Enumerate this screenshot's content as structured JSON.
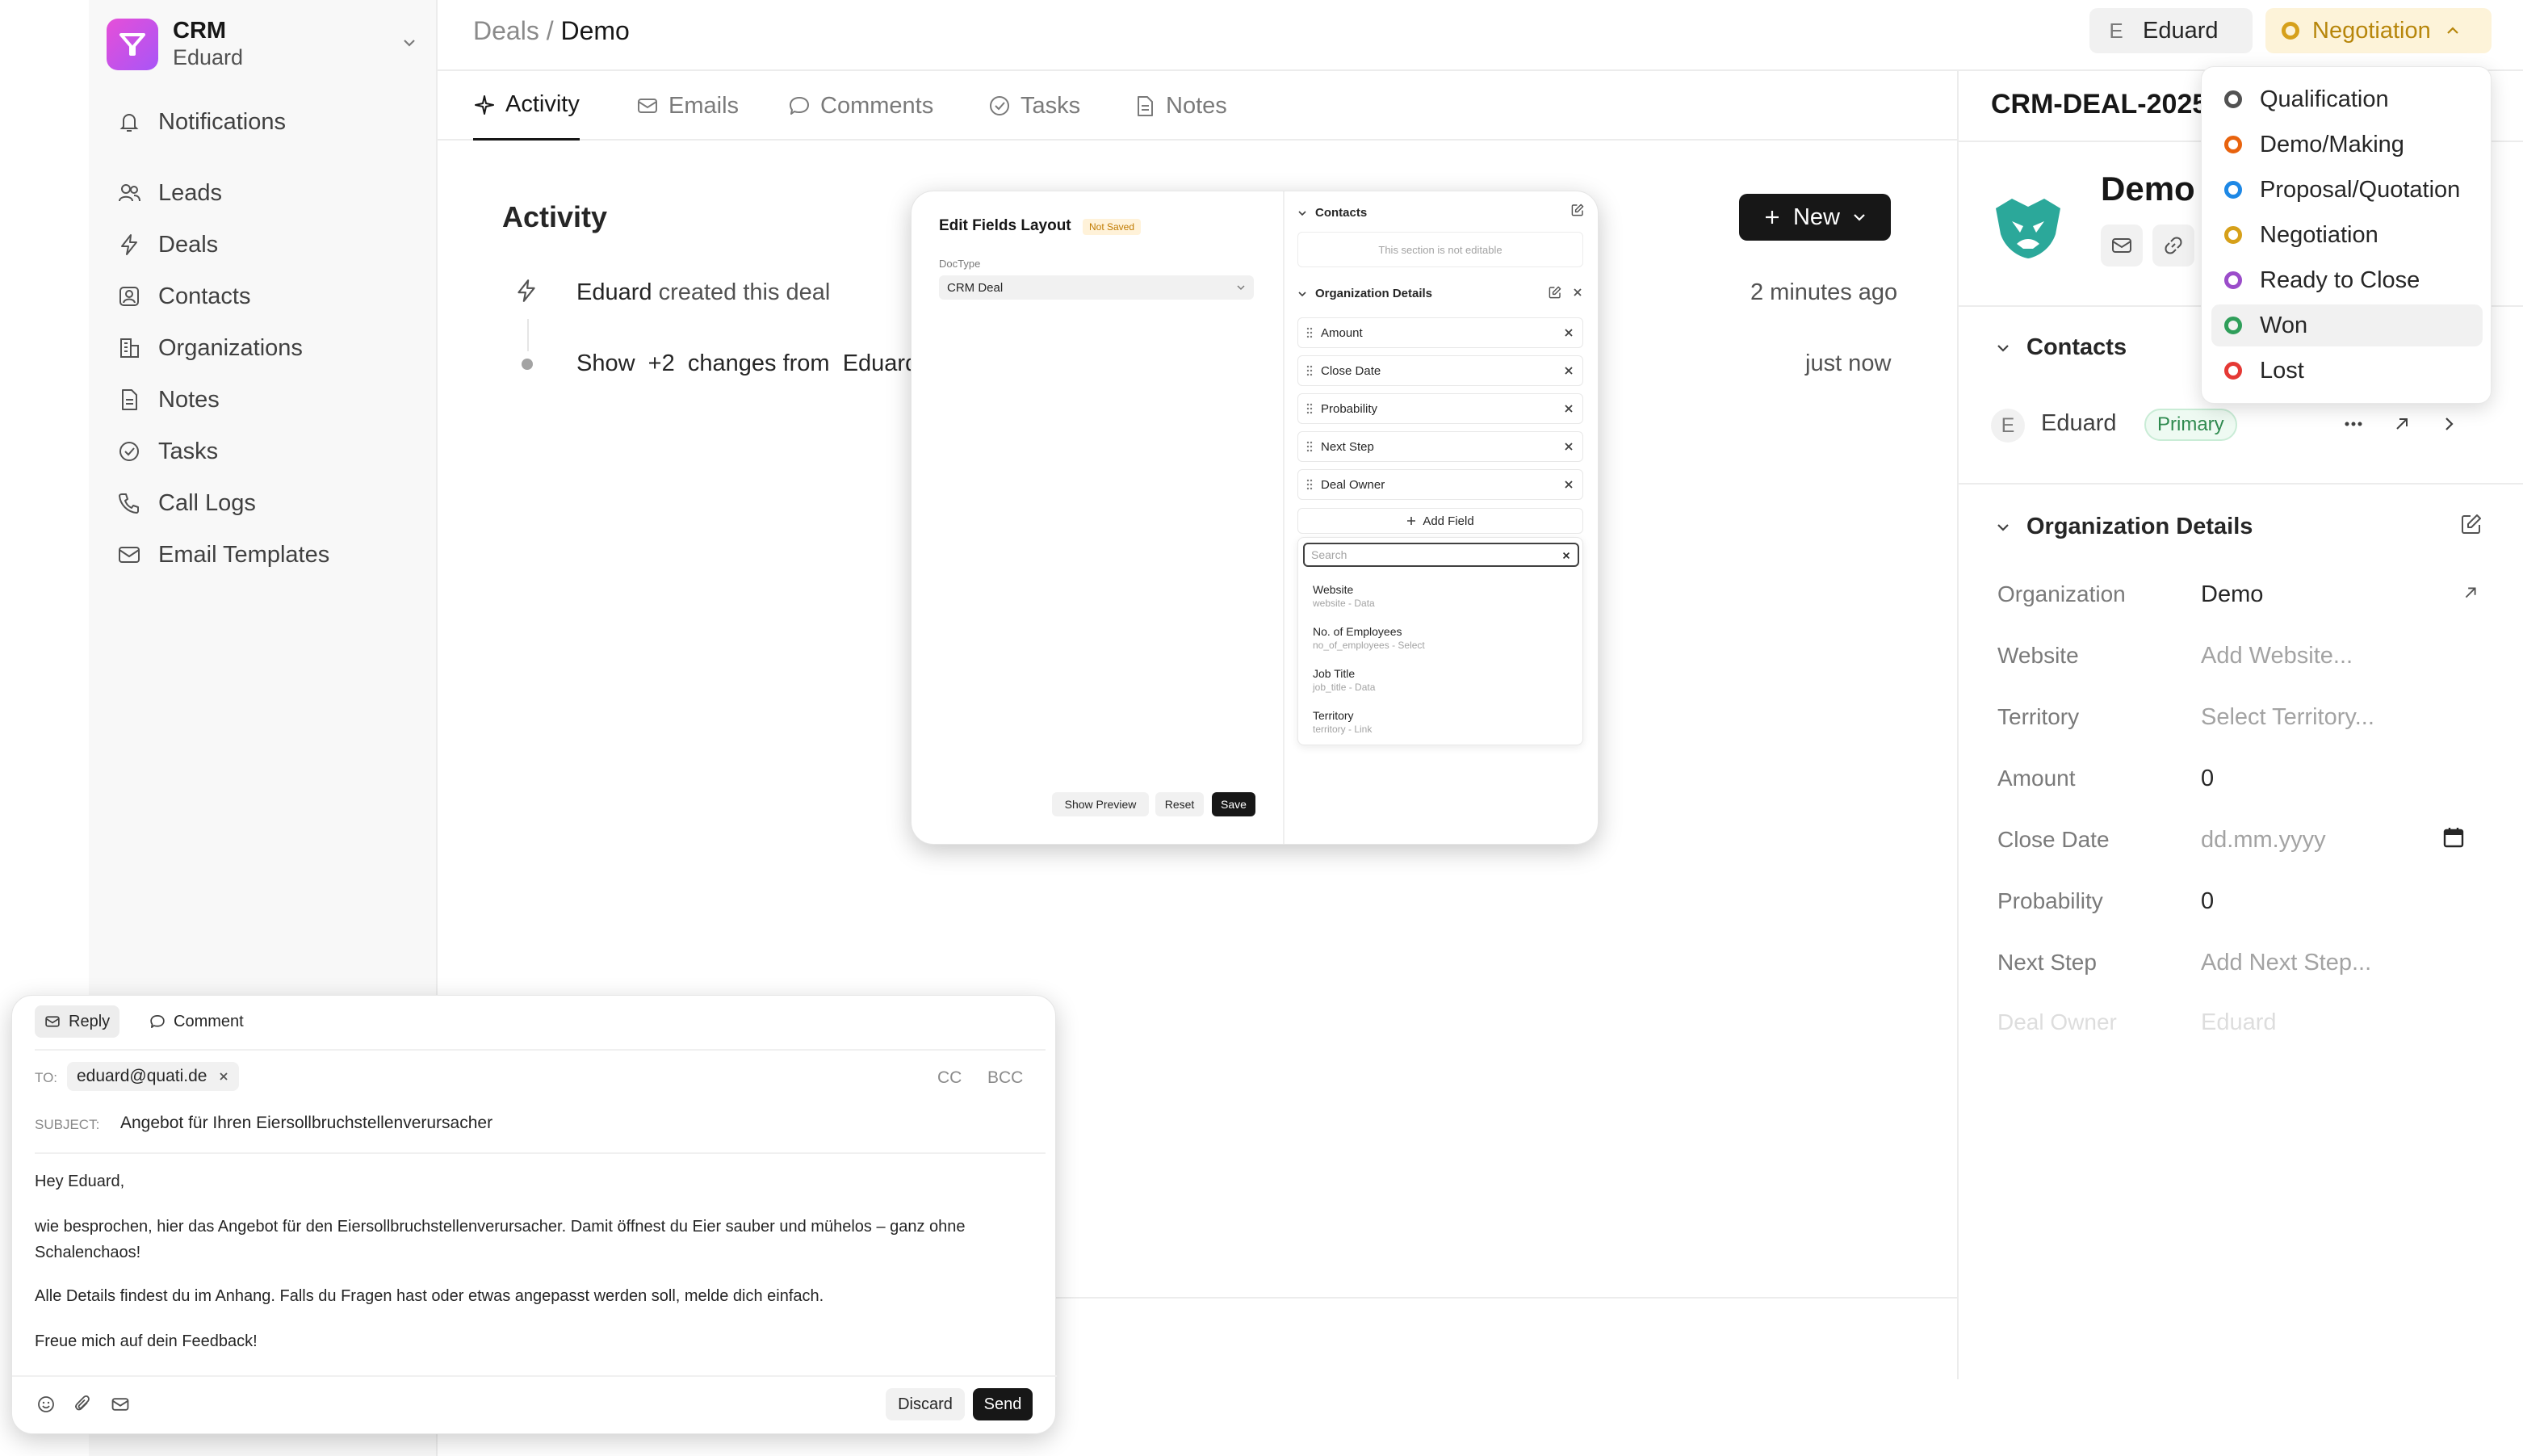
{
  "app": {
    "name": "CRM",
    "user": "Eduard"
  },
  "sidebar": {
    "items": [
      {
        "label": "Notifications",
        "icon": "bell-icon"
      },
      {
        "label": "Leads",
        "icon": "users-icon"
      },
      {
        "label": "Deals",
        "icon": "lightning-icon"
      },
      {
        "label": "Contacts",
        "icon": "contact-card-icon"
      },
      {
        "label": "Organizations",
        "icon": "building-icon"
      },
      {
        "label": "Notes",
        "icon": "note-icon"
      },
      {
        "label": "Tasks",
        "icon": "check-circle-icon"
      },
      {
        "label": "Call Logs",
        "icon": "phone-icon"
      },
      {
        "label": "Email Templates",
        "icon": "mail-icon"
      }
    ]
  },
  "header": {
    "breadcrumb_parent": "Deals",
    "breadcrumb_sep": "/",
    "breadcrumb_current": "Demo",
    "assigned_initial": "E",
    "assigned_name": "Eduard",
    "status": "Negotiation"
  },
  "tabs": [
    {
      "label": "Activity",
      "icon": "sparkle-icon",
      "active": true
    },
    {
      "label": "Emails",
      "icon": "mail-icon"
    },
    {
      "label": "Comments",
      "icon": "comment-icon"
    },
    {
      "label": "Tasks",
      "icon": "check-circle-icon"
    },
    {
      "label": "Notes",
      "icon": "note-icon"
    }
  ],
  "activity": {
    "title": "Activity",
    "new_button": "New",
    "items": [
      {
        "actor": "Eduard",
        "text": "created this deal",
        "time": "2 minutes ago"
      },
      {
        "text_prefix": "Show",
        "changes": "+2",
        "text_mid": "changes from",
        "actor": "Eduard",
        "time": "just now"
      }
    ]
  },
  "deal": {
    "id": "CRM-DEAL-2025",
    "name": "Demo",
    "contacts_title": "Contacts",
    "contact": {
      "initial": "E",
      "name": "Eduard",
      "badge": "Primary"
    },
    "org_title": "Organization Details",
    "fields": [
      {
        "label": "Organization",
        "value": "Demo",
        "placeholder": false
      },
      {
        "label": "Website",
        "value": "Add Website...",
        "placeholder": true
      },
      {
        "label": "Territory",
        "value": "Select Territory...",
        "placeholder": true
      },
      {
        "label": "Amount",
        "value": "0",
        "placeholder": false
      },
      {
        "label": "Close Date",
        "value": "dd.mm.yyyy",
        "placeholder": true
      },
      {
        "label": "Probability",
        "value": "0",
        "placeholder": false
      },
      {
        "label": "Next Step",
        "value": "Add Next Step...",
        "placeholder": true
      },
      {
        "label": "Deal Owner",
        "value": "Eduard",
        "placeholder": true
      }
    ]
  },
  "status_menu": {
    "options": [
      {
        "label": "Qualification",
        "color": "#525252"
      },
      {
        "label": "Demo/Making",
        "color": "#e8630e"
      },
      {
        "label": "Proposal/Quotation",
        "color": "#1e88e5"
      },
      {
        "label": "Negotiation",
        "color": "#d6a01a"
      },
      {
        "label": "Ready to Close",
        "color": "#9b4dca"
      },
      {
        "label": "Won",
        "color": "#2f9e5a",
        "highlighted": true
      },
      {
        "label": "Lost",
        "color": "#e53935"
      }
    ]
  },
  "modal": {
    "title": "Edit Fields Layout",
    "badge": "Not Saved",
    "doctype_label": "DocType",
    "doctype_value": "CRM Deal",
    "show_preview": "Show Preview",
    "reset": "Reset",
    "save": "Save",
    "contacts_section": "Contacts",
    "not_editable": "This section is not editable",
    "org_section": "Organization Details",
    "fields": [
      "Amount",
      "Close Date",
      "Probability",
      "Next Step",
      "Deal Owner"
    ],
    "add_field": "Add Field",
    "search_placeholder": "Search",
    "options": [
      {
        "title": "Website",
        "sub": "website - Data"
      },
      {
        "title": "No. of Employees",
        "sub": "no_of_employees - Select"
      },
      {
        "title": "Job Title",
        "sub": "job_title - Data"
      },
      {
        "title": "Territory",
        "sub": "territory - Link"
      }
    ]
  },
  "composer": {
    "reply": "Reply",
    "comment": "Comment",
    "to_label": "TO:",
    "to_value": "eduard@quati.de",
    "cc": "CC",
    "bcc": "BCC",
    "subject_label": "SUBJECT:",
    "subject": "Angebot für Ihren Eiersollbruchstellenverursacher",
    "body": [
      "Hey Eduard,",
      "wie besprochen, hier das Angebot für den Eiersollbruchstellenverursacher. Damit öffnest du Eier sauber und mühelos – ganz ohne Schalenchaos!",
      "Alle Details findest du im Anhang. Falls du Fragen hast oder etwas angepasst werden soll, melde dich einfach.",
      "Freue mich auf dein Feedback!"
    ],
    "discard": "Discard",
    "send": "Send"
  }
}
